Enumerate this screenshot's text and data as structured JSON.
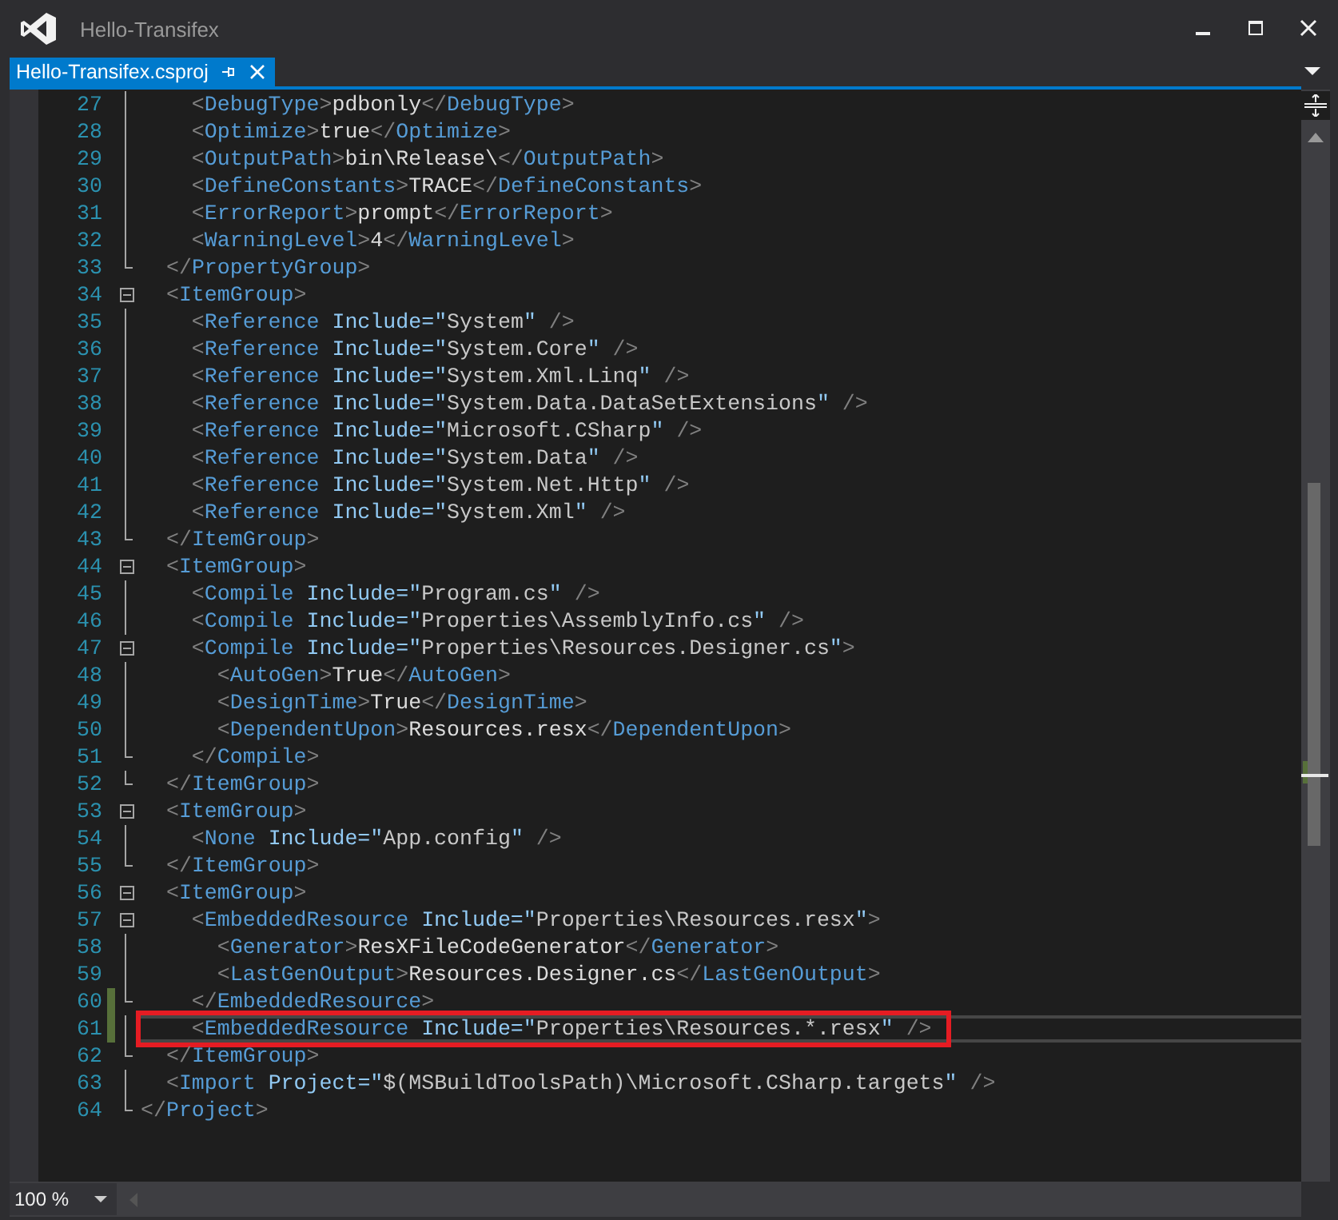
{
  "window": {
    "title": "Hello-Transifex"
  },
  "tabs": [
    {
      "label": "Hello-Transifex.csproj",
      "selected": true
    }
  ],
  "editor": {
    "lines": [
      {
        "number": "27",
        "text": "    <DebugType>pdbonly</DebugType>",
        "kind": "plain",
        "changed": false,
        "current": false,
        "annotated": false
      },
      {
        "number": "28",
        "text": "    <Optimize>true</Optimize>",
        "kind": "plain",
        "changed": false,
        "current": false,
        "annotated": false
      },
      {
        "number": "29",
        "text": "    <OutputPath>bin\\Release\\</OutputPath>",
        "kind": "plain",
        "changed": false,
        "current": false,
        "annotated": false
      },
      {
        "number": "30",
        "text": "    <DefineConstants>TRACE</DefineConstants>",
        "kind": "plain",
        "changed": false,
        "current": false,
        "annotated": false
      },
      {
        "number": "31",
        "text": "    <ErrorReport>prompt</ErrorReport>",
        "kind": "plain",
        "changed": false,
        "current": false,
        "annotated": false
      },
      {
        "number": "32",
        "text": "    <WarningLevel>4</WarningLevel>",
        "kind": "plain",
        "changed": false,
        "current": false,
        "annotated": false
      },
      {
        "number": "33",
        "text": "  </PropertyGroup>",
        "kind": "close",
        "changed": false,
        "current": false,
        "annotated": false
      },
      {
        "number": "34",
        "text": "  <ItemGroup>",
        "kind": "open",
        "changed": false,
        "current": false,
        "annotated": false
      },
      {
        "number": "35",
        "text": "    <Reference Include=\"System\" />",
        "kind": "plain",
        "changed": false,
        "current": false,
        "annotated": false
      },
      {
        "number": "36",
        "text": "    <Reference Include=\"System.Core\" />",
        "kind": "plain",
        "changed": false,
        "current": false,
        "annotated": false
      },
      {
        "number": "37",
        "text": "    <Reference Include=\"System.Xml.Linq\" />",
        "kind": "plain",
        "changed": false,
        "current": false,
        "annotated": false
      },
      {
        "number": "38",
        "text": "    <Reference Include=\"System.Data.DataSetExtensions\" />",
        "kind": "plain",
        "changed": false,
        "current": false,
        "annotated": false
      },
      {
        "number": "39",
        "text": "    <Reference Include=\"Microsoft.CSharp\" />",
        "kind": "plain",
        "changed": false,
        "current": false,
        "annotated": false
      },
      {
        "number": "40",
        "text": "    <Reference Include=\"System.Data\" />",
        "kind": "plain",
        "changed": false,
        "current": false,
        "annotated": false
      },
      {
        "number": "41",
        "text": "    <Reference Include=\"System.Net.Http\" />",
        "kind": "plain",
        "changed": false,
        "current": false,
        "annotated": false
      },
      {
        "number": "42",
        "text": "    <Reference Include=\"System.Xml\" />",
        "kind": "plain",
        "changed": false,
        "current": false,
        "annotated": false
      },
      {
        "number": "43",
        "text": "  </ItemGroup>",
        "kind": "close",
        "changed": false,
        "current": false,
        "annotated": false
      },
      {
        "number": "44",
        "text": "  <ItemGroup>",
        "kind": "open",
        "changed": false,
        "current": false,
        "annotated": false
      },
      {
        "number": "45",
        "text": "    <Compile Include=\"Program.cs\" />",
        "kind": "plain",
        "changed": false,
        "current": false,
        "annotated": false
      },
      {
        "number": "46",
        "text": "    <Compile Include=\"Properties\\AssemblyInfo.cs\" />",
        "kind": "plain",
        "changed": false,
        "current": false,
        "annotated": false
      },
      {
        "number": "47",
        "text": "    <Compile Include=\"Properties\\Resources.Designer.cs\">",
        "kind": "open",
        "changed": false,
        "current": false,
        "annotated": false
      },
      {
        "number": "48",
        "text": "      <AutoGen>True</AutoGen>",
        "kind": "plain",
        "changed": false,
        "current": false,
        "annotated": false
      },
      {
        "number": "49",
        "text": "      <DesignTime>True</DesignTime>",
        "kind": "plain",
        "changed": false,
        "current": false,
        "annotated": false
      },
      {
        "number": "50",
        "text": "      <DependentUpon>Resources.resx</DependentUpon>",
        "kind": "plain",
        "changed": false,
        "current": false,
        "annotated": false
      },
      {
        "number": "51",
        "text": "    </Compile>",
        "kind": "close",
        "changed": false,
        "current": false,
        "annotated": false
      },
      {
        "number": "52",
        "text": "  </ItemGroup>",
        "kind": "close",
        "changed": false,
        "current": false,
        "annotated": false
      },
      {
        "number": "53",
        "text": "  <ItemGroup>",
        "kind": "open",
        "changed": false,
        "current": false,
        "annotated": false
      },
      {
        "number": "54",
        "text": "    <None Include=\"App.config\" />",
        "kind": "plain",
        "changed": false,
        "current": false,
        "annotated": false
      },
      {
        "number": "55",
        "text": "  </ItemGroup>",
        "kind": "close",
        "changed": false,
        "current": false,
        "annotated": false
      },
      {
        "number": "56",
        "text": "  <ItemGroup>",
        "kind": "open",
        "changed": false,
        "current": false,
        "annotated": false
      },
      {
        "number": "57",
        "text": "    <EmbeddedResource Include=\"Properties\\Resources.resx\">",
        "kind": "open",
        "changed": false,
        "current": false,
        "annotated": false
      },
      {
        "number": "58",
        "text": "      <Generator>ResXFileCodeGenerator</Generator>",
        "kind": "plain",
        "changed": false,
        "current": false,
        "annotated": false
      },
      {
        "number": "59",
        "text": "      <LastGenOutput>Resources.Designer.cs</LastGenOutput>",
        "kind": "plain",
        "changed": false,
        "current": false,
        "annotated": false
      },
      {
        "number": "60",
        "text": "    </EmbeddedResource>",
        "kind": "close",
        "changed": true,
        "current": false,
        "annotated": false
      },
      {
        "number": "61",
        "text": "    <EmbeddedResource Include=\"Properties\\Resources.*.resx\" />",
        "kind": "plain",
        "changed": true,
        "current": true,
        "annotated": true
      },
      {
        "number": "62",
        "text": "  </ItemGroup>",
        "kind": "close",
        "changed": false,
        "current": false,
        "annotated": false
      },
      {
        "number": "63",
        "text": "  <Import Project=\"$(MSBuildToolsPath)\\Microsoft.CSharp.targets\" />",
        "kind": "plain",
        "changed": false,
        "current": false,
        "annotated": false
      },
      {
        "number": "64",
        "text": "</Project>",
        "kind": "close",
        "changed": false,
        "current": false,
        "annotated": false
      }
    ]
  },
  "status_bar": {
    "zoom": "100 %"
  }
}
